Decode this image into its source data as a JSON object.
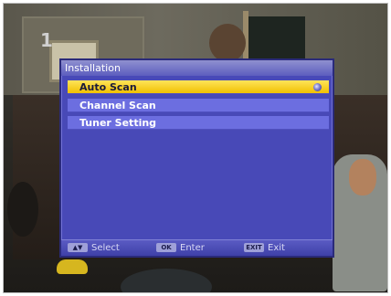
{
  "menu": {
    "title": "Installation",
    "items": [
      {
        "label": "Auto Scan",
        "selected": true
      },
      {
        "label": "Channel Scan",
        "selected": false
      },
      {
        "label": "Tuner Setting",
        "selected": false
      }
    ]
  },
  "footer": {
    "select": {
      "key": "▲▼",
      "label": "Select"
    },
    "enter": {
      "key": "OK",
      "label": "Enter"
    },
    "exit": {
      "key": "EXIT",
      "label": "Exit"
    }
  },
  "overlay": {
    "channel_logo": "1"
  },
  "colors": {
    "menu_bg": "#4849b7",
    "item_bg": "#6c6ee0",
    "selected_bg": "#f1c000",
    "title_bar": "#8f90cf"
  }
}
